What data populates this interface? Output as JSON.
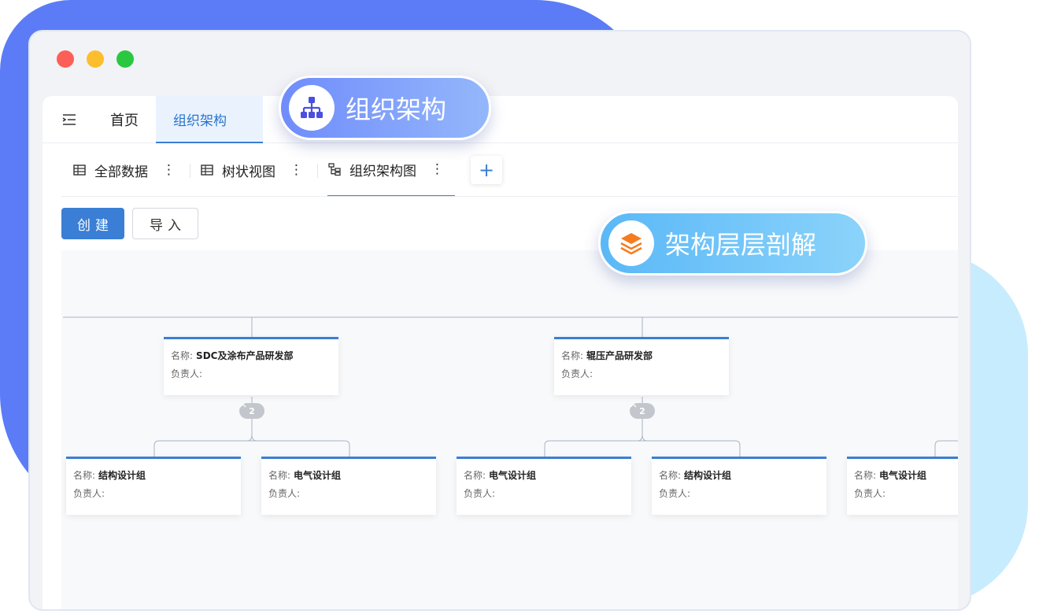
{
  "nav": {
    "home": "首页",
    "org": "组织架构"
  },
  "view_tabs": [
    {
      "label": "全部数据"
    },
    {
      "label": "树状视图"
    },
    {
      "label": "组织架构图"
    }
  ],
  "add_tab": "+",
  "kebab": "⋮",
  "actions": {
    "create": "创建",
    "import": "导入"
  },
  "org_chart": {
    "name_label": "名称:",
    "owner_label": "负责人:",
    "departments": [
      {
        "name": "SDC及涂布产品研发部",
        "owner": "",
        "child_count": "2",
        "groups": [
          {
            "name": "结构设计组",
            "owner": ""
          },
          {
            "name": "电气设计组",
            "owner": ""
          }
        ]
      },
      {
        "name": "辊压产品研发部",
        "owner": "",
        "child_count": "2",
        "groups": [
          {
            "name": "电气设计组",
            "owner": ""
          },
          {
            "name": "结构设计组",
            "owner": ""
          }
        ]
      },
      {
        "name": "",
        "owner": "",
        "groups": [
          {
            "name": "电气设计组",
            "owner": ""
          }
        ]
      }
    ]
  },
  "promo": {
    "badge1": "组织架构",
    "badge2": "架构层层剖解"
  },
  "colors": {
    "accent": "#3a7fd5",
    "bg_blob": "#5b7cf6",
    "bg_blob2": "#c7ecfd"
  }
}
